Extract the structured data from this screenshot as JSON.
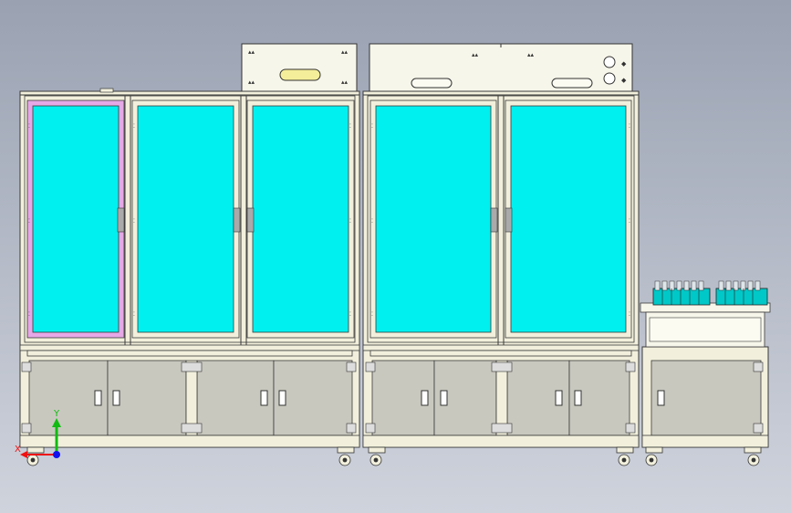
{
  "axis_triad": {
    "x_label": "X",
    "y_label": "Y"
  },
  "colors": {
    "background_top": "#9aa2b2",
    "background_bottom": "#cfd3dc",
    "frame": "#f2f0dc",
    "frame_edge": "#3a3a3a",
    "glass": "#00f0f0",
    "cabinet_panel": "#c9c8bf",
    "selected_glass_edge": "#e6a8e6",
    "handle_plate": "#f4ee9a",
    "axis_x": "#ee1111",
    "axis_y": "#11bb11",
    "axis_z": "#1111ee"
  }
}
